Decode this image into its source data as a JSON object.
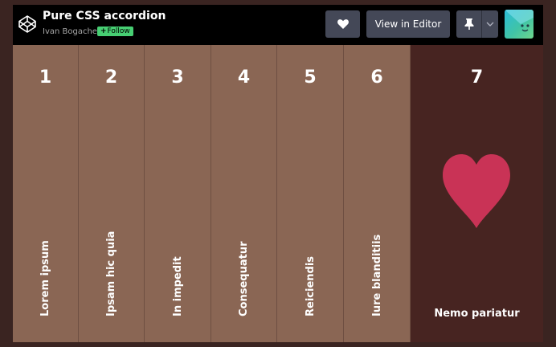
{
  "header": {
    "title": "Pure CSS accordion",
    "author": "Ivan Bogachev",
    "follow_label": "Follow",
    "view_editor_label": "View in Editor",
    "logo_icon": "codepen-logo-icon",
    "heart_icon": "heart-icon",
    "pin_icon": "pin-icon",
    "chevron_icon": "chevron-down-icon"
  },
  "accordion": {
    "panels": [
      {
        "number": "1",
        "label": "Lorem ipsum"
      },
      {
        "number": "2",
        "label": "Ipsam hic quia"
      },
      {
        "number": "3",
        "label": "In impedit"
      },
      {
        "number": "4",
        "label": "Consequatur"
      },
      {
        "number": "5",
        "label": "Reiciendis"
      },
      {
        "number": "6",
        "label": "Iure blanditiis"
      },
      {
        "number": "7",
        "label": "Nemo pariatur"
      }
    ],
    "active_index": 7,
    "colors": {
      "panel": "#8a6654",
      "active_panel": "#472421",
      "heart": "#c93356"
    }
  }
}
